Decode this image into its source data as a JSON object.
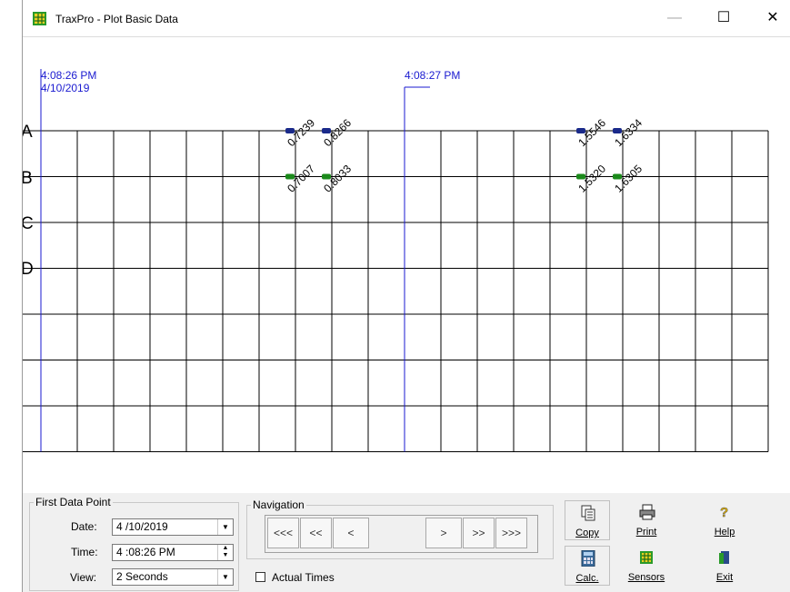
{
  "window": {
    "title": "TraxPro - Plot Basic Data"
  },
  "plot": {
    "rows": [
      "A",
      "B",
      "C",
      "D"
    ],
    "time_left": "4:08:26 PM",
    "date_left": "4/10/2019",
    "time_mid": "4:08:27 PM",
    "points": [
      {
        "row": "A",
        "col": 7,
        "value": "0.7239",
        "color": "#1a2a8a"
      },
      {
        "row": "A",
        "col": 8,
        "value": "0.8266",
        "color": "#1a2a8a"
      },
      {
        "row": "B",
        "col": 7,
        "value": "0.7007",
        "color": "#1b8a1b"
      },
      {
        "row": "B",
        "col": 8,
        "value": "0.8033",
        "color": "#1b8a1b"
      },
      {
        "row": "A",
        "col": 15,
        "value": "1.5546",
        "color": "#1a2a8a"
      },
      {
        "row": "A",
        "col": 16,
        "value": "1.6334",
        "color": "#1a2a8a"
      },
      {
        "row": "B",
        "col": 15,
        "value": "1.5320",
        "color": "#1b8a1b"
      },
      {
        "row": "B",
        "col": 16,
        "value": "1.6305",
        "color": "#1b8a1b"
      }
    ]
  },
  "first_data_point": {
    "legend": "First Data Point",
    "date_label": "Date:",
    "date_value": "4 /10/2019",
    "time_label": "Time:",
    "time_value": "4 :08:26 PM",
    "view_label": "View:",
    "view_value": "2 Seconds"
  },
  "navigation": {
    "legend": "Navigation",
    "buttons": [
      "<<<",
      "<<",
      "<",
      ">",
      ">>",
      ">>>"
    ],
    "actual_times_label": "Actual Times"
  },
  "toolbar": {
    "copy": "Copy",
    "print": "Print",
    "help": "Help",
    "calc": "Calc.",
    "sensors": "Sensors",
    "exit": "Exit"
  },
  "colors": {
    "accent": "#1a1ad0",
    "series_a": "#1a2a8a",
    "series_b": "#1b8a1b"
  }
}
